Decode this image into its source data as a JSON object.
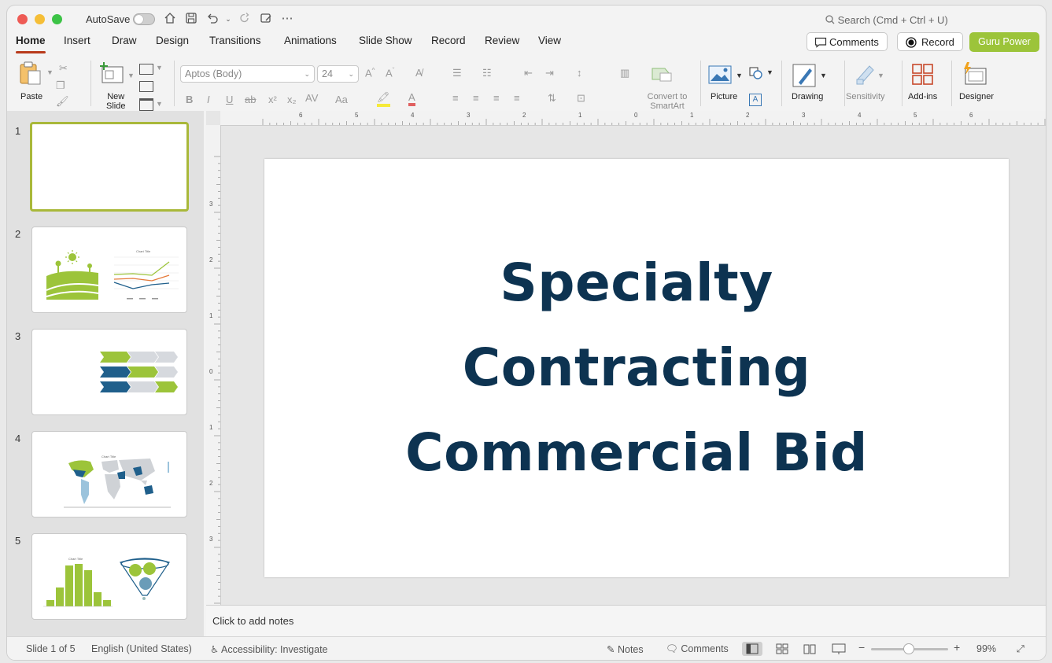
{
  "titlebar": {
    "autosave_label": "AutoSave",
    "search_placeholder": "Search (Cmd + Ctrl + U)"
  },
  "tabs": [
    {
      "label": "Home",
      "active": true
    },
    {
      "label": "Insert"
    },
    {
      "label": "Draw"
    },
    {
      "label": "Design"
    },
    {
      "label": "Transitions"
    },
    {
      "label": "Animations"
    },
    {
      "label": "Slide Show"
    },
    {
      "label": "Record"
    },
    {
      "label": "Review"
    },
    {
      "label": "View"
    }
  ],
  "header_buttons": {
    "comments": "Comments",
    "record": "Record",
    "guru": "Guru Power"
  },
  "ribbon": {
    "paste": "Paste",
    "new_slide_1": "New",
    "new_slide_2": "Slide",
    "font_name": "Aptos (Body)",
    "font_size": "24",
    "convert_1": "Convert to",
    "convert_2": "SmartArt",
    "picture": "Picture",
    "drawing": "Drawing",
    "sensitivity": "Sensitivity",
    "addins": "Add-ins",
    "designer": "Designer"
  },
  "thumbnails": [
    {
      "num": "1"
    },
    {
      "num": "2",
      "chart_title": "Chart Title"
    },
    {
      "num": "3"
    },
    {
      "num": "4",
      "chart_title": "Chart Title"
    },
    {
      "num": "5",
      "chart_title": "Chart Title"
    }
  ],
  "slide": {
    "title_line1": "Specialty",
    "title_line2": "Contracting",
    "title_line3": "Commercial Bid"
  },
  "ruler": {
    "h_labels": [
      "6",
      "5",
      "4",
      "3",
      "2",
      "1",
      "0",
      "1",
      "2",
      "3",
      "4",
      "5",
      "6"
    ],
    "v_labels": [
      "3",
      "2",
      "1",
      "0",
      "1",
      "2",
      "3"
    ]
  },
  "notes_placeholder": "Click to add notes",
  "status": {
    "slide_count": "Slide 1 of 5",
    "language": "English (United States)",
    "accessibility": "Accessibility: Investigate",
    "notes": "Notes",
    "comments": "Comments",
    "zoom": "99%"
  },
  "colors": {
    "title": "#0d3351",
    "accent_green": "#9cc43a",
    "accent_blue": "#1f5f8b",
    "tab_underline": "#b83a1b"
  }
}
